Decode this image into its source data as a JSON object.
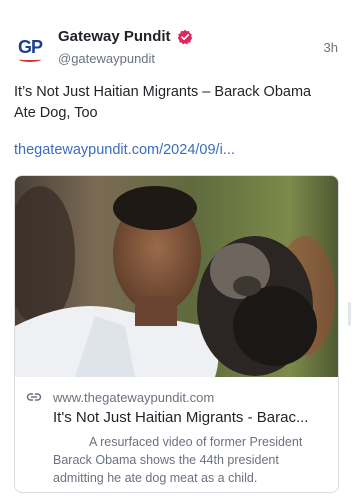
{
  "author": {
    "display_name": "Gateway Pundit",
    "handle": "@gatewaypundit",
    "avatar_text": "GP",
    "verified": true
  },
  "post": {
    "timestamp": "3h",
    "text": "It’s Not Just Haitian Migrants – Barack Obama Ate Dog, Too",
    "link_text": "thegatewaypundit.com/2024/09/i..."
  },
  "card": {
    "domain": "www.thegatewaypundit.com",
    "title": "It's Not Just Haitian Migrants - Barac...",
    "description": "A resurfaced video of former President Barack Obama shows the 44th president admitting he ate dog meat as a child."
  },
  "colors": {
    "link": "#3b6dbf",
    "verified_badge": "#e0245e",
    "text_primary": "#1f2328",
    "text_secondary": "#6b7280"
  }
}
